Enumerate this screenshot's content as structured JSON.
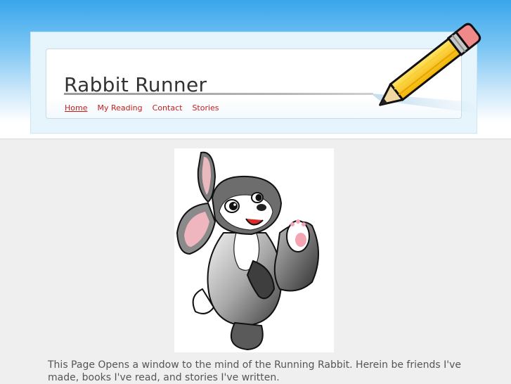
{
  "site": {
    "title": "Rabbit Runner"
  },
  "nav": {
    "items": [
      {
        "label": "Home",
        "active": true
      },
      {
        "label": "My Reading",
        "active": false
      },
      {
        "label": "Contact",
        "active": false
      },
      {
        "label": "Stories",
        "active": false
      }
    ]
  },
  "main": {
    "intro_text": "This Page Opens a window to the mind of the Running Rabbit. Herein be friends I've made, books I've read, and stories I've written."
  },
  "icons": {
    "header_decoration": "pencil-icon",
    "hero_image": "cartoon-rabbit-image"
  },
  "colors": {
    "nav_link": "#cc1a1a",
    "title_text": "#333333",
    "body_text": "#555555",
    "page_background": "#efefef",
    "sky_top": "#39a6ec"
  }
}
